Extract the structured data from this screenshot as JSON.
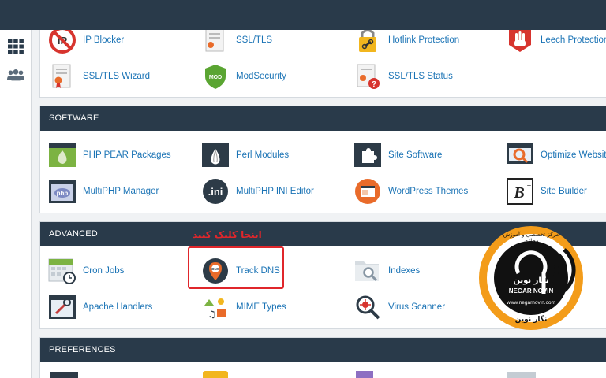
{
  "top_section": {
    "items": [
      {
        "label": "IP Blocker",
        "icon": "ip-blocker-icon"
      },
      {
        "label": "SSL/TLS",
        "icon": "certificate-icon"
      },
      {
        "label": "Hotlink Protection",
        "icon": "padlock-link-icon"
      },
      {
        "label": "Leech Protection",
        "icon": "hand-stop-icon"
      },
      {
        "label": "SSL/TLS Wizard",
        "icon": "certificate-wizard-icon"
      },
      {
        "label": "ModSecurity",
        "icon": "shield-icon"
      },
      {
        "label": "SSL/TLS Status",
        "icon": "certificate-status-icon"
      }
    ]
  },
  "software": {
    "title": "SOFTWARE",
    "items": [
      {
        "label": "PHP PEAR Packages",
        "icon": "pear-icon"
      },
      {
        "label": "Perl Modules",
        "icon": "onion-icon"
      },
      {
        "label": "Site Software",
        "icon": "puzzle-icon"
      },
      {
        "label": "Optimize Website",
        "icon": "optimize-icon"
      },
      {
        "label": "MultiPHP Manager",
        "icon": "php-elephant-icon"
      },
      {
        "label": "MultiPHP INI Editor",
        "icon": "ini-icon"
      },
      {
        "label": "WordPress Themes",
        "icon": "wordpress-icon"
      },
      {
        "label": "Site Builder",
        "icon": "site-builder-icon"
      }
    ]
  },
  "advanced": {
    "title": "ADVANCED",
    "annotation": "اینجا کلیک کنید",
    "items": [
      {
        "label": "Cron Jobs",
        "icon": "calendar-clock-icon"
      },
      {
        "label": "Track DNS",
        "icon": "dns-pin-icon"
      },
      {
        "label": "Indexes",
        "icon": "folder-search-icon"
      },
      {
        "label": "Apache Handlers",
        "icon": "apache-handler-icon"
      },
      {
        "label": "MIME Types",
        "icon": "mime-types-icon"
      },
      {
        "label": "Virus Scanner",
        "icon": "virus-scanner-icon"
      }
    ]
  },
  "preferences": {
    "title": "PREFERENCES"
  },
  "watermark": {
    "name_fa": "نگار نوین",
    "name_en": "NEGAR NOVIN",
    "url": "www.negarnovin.com",
    "tagline_fa": "مرکز تخصصی و آموزش مجازی",
    "footer_fa": "نگار نوین"
  },
  "colors": {
    "header_bg": "#293a4a",
    "link": "#1a73b5",
    "highlight": "#e0262b",
    "watermark_orange": "#f39c1a"
  }
}
